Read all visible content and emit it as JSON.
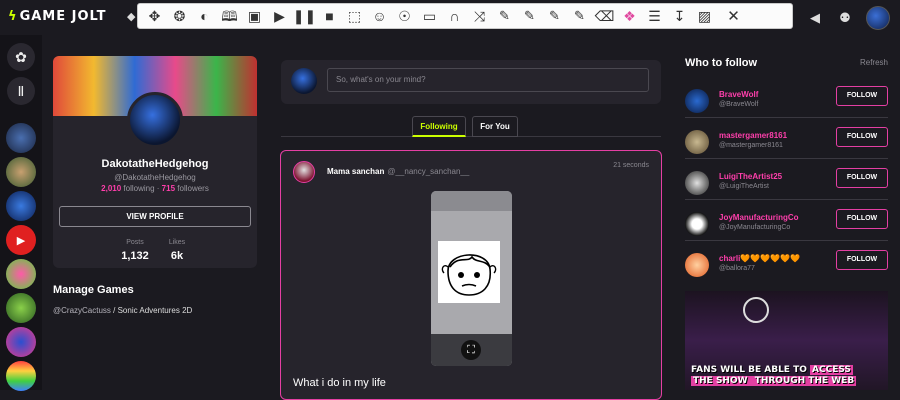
{
  "header": {
    "logo_mark": "ϟ",
    "logo_text": "GAME JOLT",
    "icons": [
      "bell-icon",
      "people-icon",
      "avatar"
    ]
  },
  "toolbar": {
    "tools": [
      "move-icon",
      "lasso-icon",
      "color-picker-icon",
      "reader-icon",
      "image-icon",
      "play-icon",
      "pause-icon",
      "stop-icon",
      "screenshot-icon",
      "voice-icon",
      "speech-icon",
      "screen-icon",
      "headphones-icon",
      "shuffle-icon",
      "highlight-yellow-icon",
      "highlight-green-icon",
      "highlight-cyan-icon",
      "highlight-pink-icon",
      "eraser-icon",
      "palette-icon",
      "list-icon",
      "sort-icon",
      "export-icon"
    ],
    "highlight_colors": [
      "#f5e23b",
      "#7fdd4a",
      "#42d6e8",
      "#f04ac8"
    ],
    "close_label": "✕"
  },
  "profile": {
    "name": "DakotatheHedgehog",
    "handle": "@DakotatheHedgehog",
    "following_count": "2,010",
    "following_label": "following",
    "followers_count": "715",
    "followers_label": "followers",
    "view_button": "VIEW PROFILE",
    "posts_label": "Posts",
    "posts_value": "1,132",
    "likes_label": "Likes",
    "likes_value": "6k"
  },
  "manage": {
    "title": "Manage Games",
    "item_handle": "@CrazyCactuss",
    "item_sep": " / ",
    "item_game": "Sonic Adventures 2D"
  },
  "feed": {
    "compose_placeholder": "So, what's on your mind?",
    "tabs": [
      {
        "label": "Following",
        "active": true
      },
      {
        "label": "For You",
        "active": false
      }
    ],
    "post": {
      "author": "Mama sanchan",
      "handle": "@__nancy_sanchan__",
      "time": "21 seconds",
      "text": "What i do in my life"
    }
  },
  "who_to_follow": {
    "title": "Who to follow",
    "refresh": "Refresh",
    "button_label": "FOLLOW",
    "users": [
      {
        "name": "BraveWolf",
        "handle": "@BraveWolf"
      },
      {
        "name": "mastergamer8161",
        "handle": "@mastergamer8161"
      },
      {
        "name": "LuigiTheArtist25",
        "handle": "@LuigiTheArtist"
      },
      {
        "name": "JoyManufacturingCo",
        "handle": "@JoyManufacturingCo"
      },
      {
        "name": "charli🧡🧡🧡🧡🧡🧡",
        "handle": "@ballora77"
      }
    ]
  },
  "ad": {
    "line1_pre": "FANS WILL BE ABLE TO ",
    "line1_hl": "ACCESS",
    "line2_pre": "THE SHOW ",
    "line2_hl": "THROUGH THE WEB"
  },
  "colors": {
    "accent_pink": "#ff3fac",
    "accent_lime": "#ccff00",
    "bg": "#1b1a20",
    "card": "#26242c"
  }
}
